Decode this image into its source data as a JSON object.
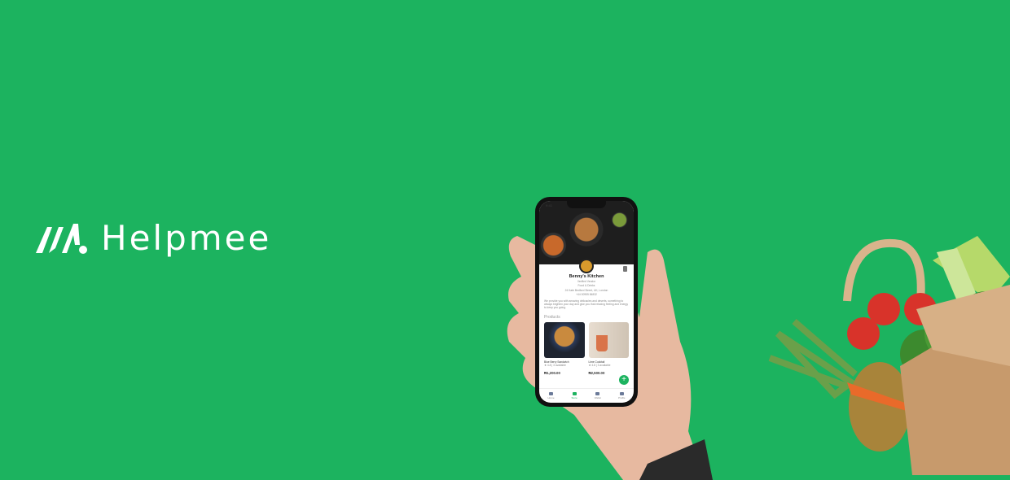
{
  "brand": {
    "name": "Helpmee"
  },
  "phone": {
    "status_time": "9:41",
    "vendor_name": "Benny's Kitchen",
    "badge": "Verified Vendor",
    "category": "Food & Drinks",
    "address": "24 Kate Bedford Street, UK, London",
    "phone": "+44 00955 84832",
    "description": "We provide you with amazing delicacies and deserts, something to always brighten your day and give you that relaxing feeling and energy to keep you going.",
    "products_heading": "Products",
    "products": [
      {
        "name": "Blue Berry Sandwich",
        "meta": "★ 4.8 | 3 available",
        "price": "₦1,200.00"
      },
      {
        "name": "Lime Cocktail",
        "meta": "★ 4.8 | 3 available",
        "price": "₦2,500.00"
      }
    ],
    "add_label": "+",
    "nav": [
      "Home",
      "Store",
      "Wallet",
      "Profile"
    ]
  },
  "colors": {
    "background": "#1cb35f"
  }
}
